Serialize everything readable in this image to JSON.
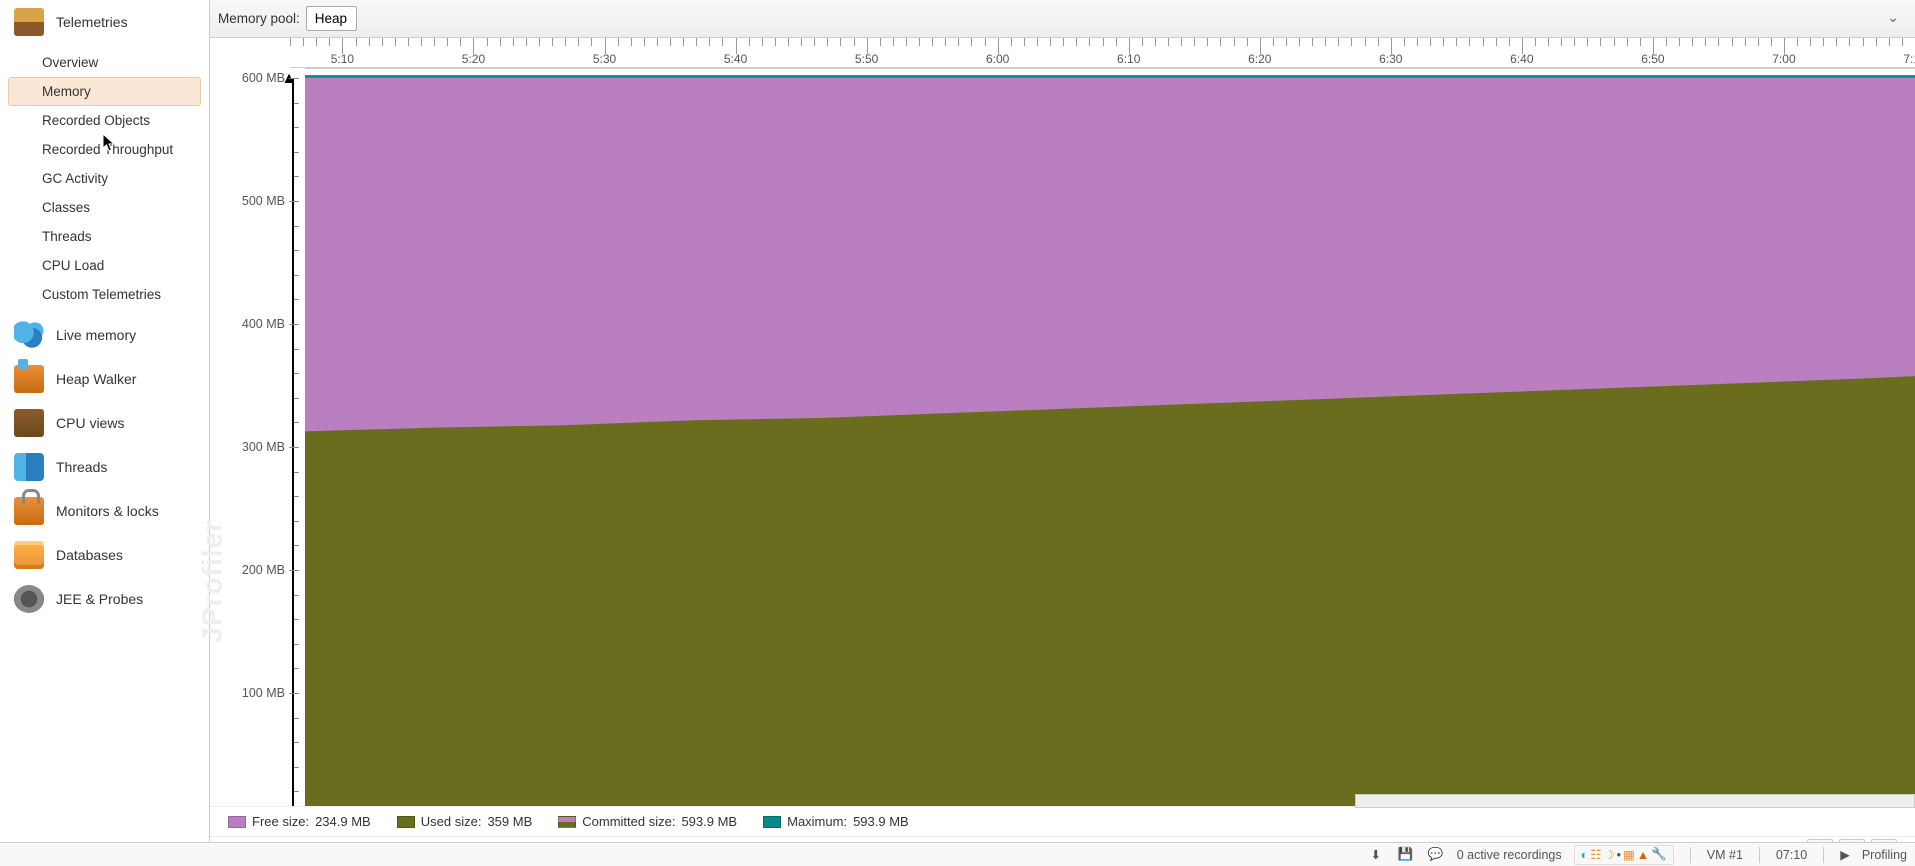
{
  "sidebar": {
    "sections": [
      {
        "id": "telemetries",
        "label": "Telemetries",
        "icon": "ic-tel",
        "expanded": true,
        "items": [
          {
            "label": "Overview"
          },
          {
            "label": "Memory",
            "selected": true
          },
          {
            "label": "Recorded Objects"
          },
          {
            "label": "Recorded Throughput"
          },
          {
            "label": "GC Activity"
          },
          {
            "label": "Classes"
          },
          {
            "label": "Threads"
          },
          {
            "label": "CPU Load"
          },
          {
            "label": "Custom Telemetries"
          }
        ]
      },
      {
        "id": "live-memory",
        "label": "Live memory",
        "icon": "ic-live"
      },
      {
        "id": "heap-walker",
        "label": "Heap Walker",
        "icon": "ic-heap"
      },
      {
        "id": "cpu-views",
        "label": "CPU views",
        "icon": "ic-cpu"
      },
      {
        "id": "threads",
        "label": "Threads",
        "icon": "ic-thr"
      },
      {
        "id": "monitors-locks",
        "label": "Monitors & locks",
        "icon": "ic-lock"
      },
      {
        "id": "databases",
        "label": "Databases",
        "icon": "ic-db"
      },
      {
        "id": "jee-probes",
        "label": "JEE & Probes",
        "icon": "ic-jee"
      }
    ],
    "watermark": "JProfiler"
  },
  "topbar": {
    "label": "Memory pool:",
    "selected": "Heap"
  },
  "chart_data": {
    "type": "area",
    "title": "",
    "xlabel": "",
    "ylabel": "",
    "y_unit": "MB",
    "ylim": [
      0,
      600
    ],
    "y_ticks": [
      100,
      200,
      300,
      400,
      500,
      600
    ],
    "x_ticks": [
      "5:10",
      "5:20",
      "5:30",
      "5:40",
      "5:50",
      "6:00",
      "6:10",
      "6:20",
      "6:30",
      "6:40",
      "6:50",
      "7:00"
    ],
    "x_range_sec": [
      306,
      430
    ],
    "series": [
      {
        "name": "Committed size",
        "color": "#b97fc0",
        "values_mb": 593.9,
        "constant": true
      },
      {
        "name": "Used size",
        "color": "#6b6d1e",
        "x_sec": [
          306,
          316,
          326,
          336,
          346,
          356,
          366,
          376,
          386,
          396,
          406,
          416,
          426,
          430
        ],
        "values_mb": [
          305,
          308,
          310,
          314,
          316,
          320,
          324,
          328,
          332,
          336,
          340,
          344,
          348,
          350
        ]
      }
    ],
    "legend": [
      {
        "label": "Free size:",
        "value": "234.9 MB",
        "swatch": "sw-free"
      },
      {
        "label": "Used size:",
        "value": "359 MB",
        "swatch": "sw-used"
      },
      {
        "label": "Committed size:",
        "value": "593.9 MB",
        "swatch": "sw-comm"
      },
      {
        "label": "Maximum:",
        "value": "593.9 MB",
        "swatch": "sw-max"
      }
    ]
  },
  "statusbar": {
    "recordings": "0 active recordings",
    "vm": "VM #1",
    "time": "07:10",
    "mode": "Profiling"
  },
  "colors": {
    "free": "#b97fc0",
    "used": "#6b6d1e",
    "committed_top": "#b97fc0",
    "max": "#0a8a8a",
    "selection": "#fbe7d6"
  }
}
